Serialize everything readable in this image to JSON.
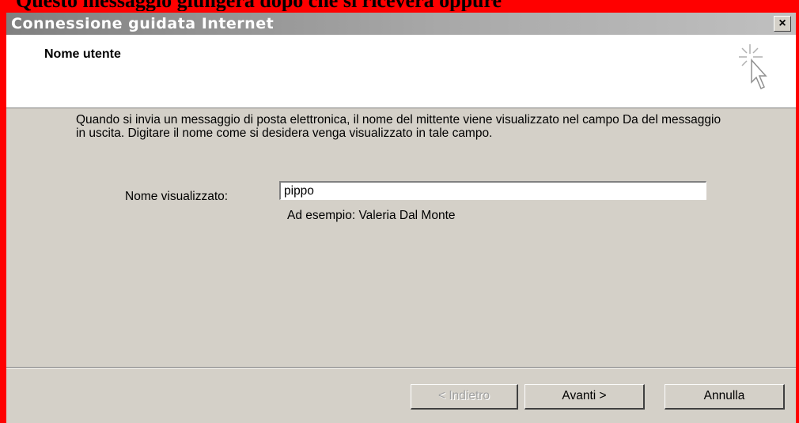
{
  "page_header_cropped": "Questo messaggio giungerà dopo che si riceverà oppure",
  "window": {
    "title": "Connessione guidata Internet",
    "close_label": "×"
  },
  "header": {
    "title": "Nome utente"
  },
  "body": {
    "description": "Quando si invia un messaggio di posta elettronica, il nome del mittente viene visualizzato nel campo Da del messaggio in uscita. Digitare il nome come si desidera venga visualizzato in tale campo."
  },
  "field": {
    "label": "Nome visualizzato:",
    "value": "pippo",
    "example": "Ad esempio: Valeria Dal Monte"
  },
  "buttons": {
    "back": "< Indietro",
    "next": "Avanti >",
    "cancel": "Annulla"
  }
}
